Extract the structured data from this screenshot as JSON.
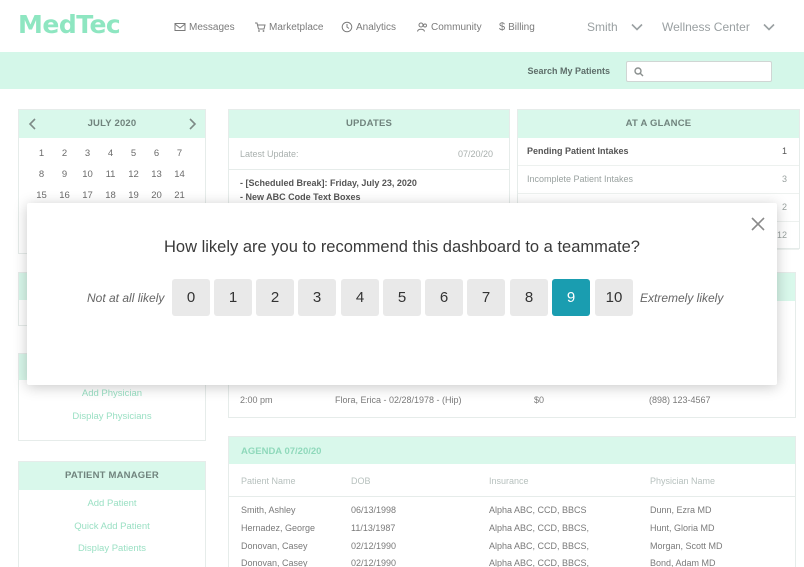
{
  "app": {
    "logo": "MedTec"
  },
  "nav": {
    "items": [
      {
        "label": "Messages",
        "icon": "mail-icon"
      },
      {
        "label": "Marketplace",
        "icon": "cart-icon"
      },
      {
        "label": "Analytics",
        "icon": "clock-icon"
      },
      {
        "label": "Community",
        "icon": "people-icon"
      },
      {
        "label": "Billing",
        "icon": "dollar-icon"
      }
    ],
    "user": "Smith",
    "location": "Wellness Center"
  },
  "search": {
    "label": "Search My Patients",
    "placeholder": ""
  },
  "calendar": {
    "month": "JULY 2020",
    "rows": [
      [
        "1",
        "2",
        "3",
        "4",
        "5",
        "6",
        "7"
      ],
      [
        "8",
        "9",
        "10",
        "11",
        "12",
        "13",
        "14"
      ],
      [
        "15",
        "16",
        "17",
        "18",
        "19",
        "20",
        "21"
      ]
    ]
  },
  "updates": {
    "title": "UPDATES",
    "latest_label": "Latest Update:",
    "latest_date": "07/20/20",
    "items": [
      "- [Scheduled Break]: Friday, July 23, 2020",
      "- New ABC Code Text Boxes"
    ]
  },
  "glance": {
    "title": "AT A GLANCE",
    "rows": [
      {
        "label": "Pending Patient Intakes",
        "value": "1"
      },
      {
        "label": "Incomplete Patient Intakes",
        "value": "3"
      },
      {
        "label": "",
        "value": "2"
      },
      {
        "label": "",
        "value": "12"
      }
    ]
  },
  "physician_menu": {
    "items": [
      "Add Physician",
      "Display Physicians"
    ]
  },
  "patient_manager": {
    "title": "PATIENT MANAGER",
    "items": [
      "Add Patient",
      "Quick Add Patient",
      "Display Patients"
    ]
  },
  "schedule_row": {
    "time": "2:00 pm",
    "patient": "Flora, Erica - 02/28/1978 - (Hip)",
    "amount": "$0",
    "phone": "(898) 123-4567"
  },
  "agenda": {
    "title": "AGENDA 07/20/20",
    "columns": [
      "Patient Name",
      "DOB",
      "Insurance",
      "Physician Name"
    ],
    "rows": [
      [
        "Smith, Ashley",
        "06/13/1998",
        "Alpha ABC, CCD, BBCS",
        "Dunn, Ezra MD"
      ],
      [
        "Hernadez, George",
        "11/13/1987",
        "Alpha ABC, CCD, BBCS,",
        "Hunt, Gloria MD"
      ],
      [
        "Donovan, Casey",
        "02/12/1990",
        "Alpha ABC, CCD, BBCS,",
        "Morgan, Scott MD"
      ],
      [
        "Donovan, Casey",
        "02/12/1990",
        "Alpha ABC, CCD, BBCS,",
        "Bond, Adam MD"
      ]
    ]
  },
  "survey": {
    "question": "How likely are you to recommend this dashboard to a teammate?",
    "low_label": "Not at all likely",
    "high_label": "Extremely likely",
    "scores": [
      "0",
      "1",
      "2",
      "3",
      "4",
      "5",
      "6",
      "7",
      "8",
      "9",
      "10"
    ],
    "selected": "9"
  },
  "colors": {
    "accent": "#1a9db0",
    "mint": "#d4f7e9",
    "logo": "#8ee6c1"
  }
}
